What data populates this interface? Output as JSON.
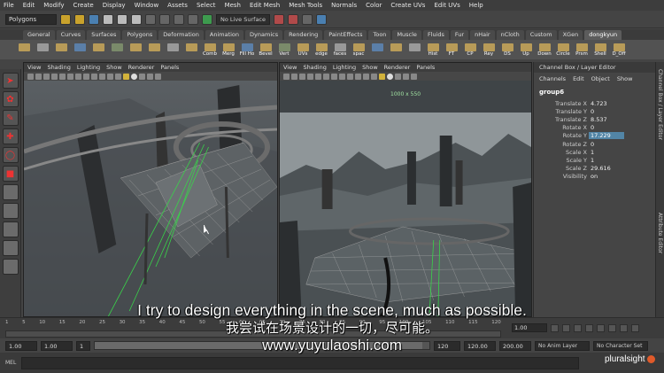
{
  "menubar": [
    "File",
    "Edit",
    "Modify",
    "Create",
    "Display",
    "Window",
    "Assets",
    "Select",
    "Mesh",
    "Edit Mesh",
    "Mesh Tools",
    "Normals",
    "Color",
    "Create UVs",
    "Edit UVs",
    "Help"
  ],
  "toolbar": {
    "menuset": "Polygons",
    "live_surface": "No Live Surface"
  },
  "shelf_tabs": [
    "General",
    "Curves",
    "Surfaces",
    "Polygons",
    "Deformation",
    "Animation",
    "Dynamics",
    "Rendering",
    "PaintEffects",
    "Toon",
    "Muscle",
    "Fluids",
    "Fur",
    "nHair",
    "nCloth",
    "Custom",
    "XGen",
    "dongkyun"
  ],
  "active_shelf": "dongkyun",
  "shelf_labels": [
    "",
    "",
    "",
    "",
    "",
    "",
    "",
    "",
    "",
    "",
    "Comb",
    "Merg",
    "Fill Ho",
    "Bevel",
    "Vert",
    "UVs",
    "edge",
    "faces",
    "spac",
    "",
    "",
    "",
    "Hist",
    "FT",
    "CP",
    "Rey",
    "DS",
    "Up",
    "Down",
    "Circle",
    "Prsm",
    "Shell",
    "D_Off"
  ],
  "viewport_menu": [
    "View",
    "Shading",
    "Lighting",
    "Show",
    "Renderer",
    "Panels"
  ],
  "resolution_gate": "1000 x 550",
  "channel_box": {
    "header": "Channel Box / Layer Editor",
    "menu": [
      "Channels",
      "Edit",
      "Object",
      "Show"
    ],
    "object": "group6",
    "attributes": [
      {
        "name": "Translate X",
        "value": "4.723"
      },
      {
        "name": "Translate Y",
        "value": "0"
      },
      {
        "name": "Translate Z",
        "value": "8.537"
      },
      {
        "name": "Rotate X",
        "value": "0"
      },
      {
        "name": "Rotate Y",
        "value": "17.229"
      },
      {
        "name": "Rotate Z",
        "value": "0"
      },
      {
        "name": "Scale X",
        "value": "1"
      },
      {
        "name": "Scale Y",
        "value": "1"
      },
      {
        "name": "Scale Z",
        "value": "29.616"
      },
      {
        "name": "Visibility",
        "value": "on"
      }
    ]
  },
  "side_tabs": [
    "Channel Box / Layer Editor",
    "Attribute Editor"
  ],
  "timeline": {
    "ticks": [
      "1",
      "5",
      "10",
      "15",
      "20",
      "25",
      "30",
      "35",
      "40",
      "45",
      "50",
      "55",
      "60",
      "65",
      "70",
      "75",
      "80",
      "85",
      "90",
      "95",
      "100",
      "105",
      "110",
      "115",
      "120"
    ],
    "current_frame": "1.00"
  },
  "range": {
    "start": "1.00",
    "start2": "1.00",
    "frame": "1",
    "end1": "120",
    "end2": "120.00",
    "end3": "200.00",
    "anim_layer": "No Anim Layer",
    "char_set": "No Character Set"
  },
  "command_line": {
    "label": "MEL"
  },
  "subtitles": {
    "en": "I try to design everything in the scene, much as possible.",
    "zh": "我尝试在场景设计的一切，尽可能。",
    "site": "www.yuyulaoshi.com"
  },
  "watermark": "pluralsight"
}
